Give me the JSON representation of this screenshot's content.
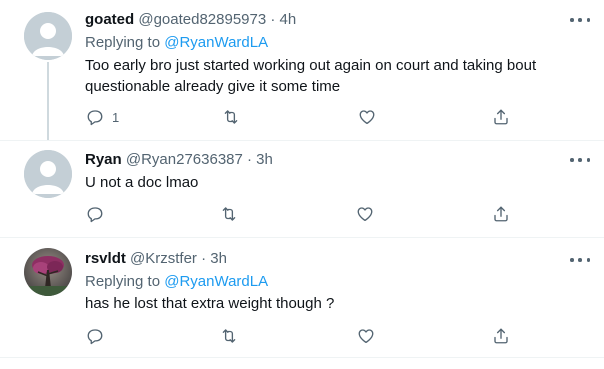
{
  "tweets": [
    {
      "name": "goated",
      "handle": "@goated82895973",
      "time": "· 4h",
      "replying_label": "Replying to",
      "replying_to": "@RyanWardLA",
      "text_line1": "Too early bro just started working out again on court and taking bout",
      "text_line2": "questionable already give it some time",
      "reply_count": "1",
      "avatar": "default-avatar-icon"
    },
    {
      "name": "Ryan",
      "handle": "@Ryan27636387",
      "time": "· 3h",
      "text_line1": "U not a doc lmao",
      "reply_count": "",
      "avatar": "default-avatar-icon"
    },
    {
      "name": "rsvldt",
      "handle": "@Krzstfer",
      "time": "· 3h",
      "replying_label": "Replying to",
      "replying_to": "@RyanWardLA",
      "text_line1": "has he lost that extra weight though ?",
      "reply_count": "",
      "avatar": "tree-avatar-photo"
    }
  ],
  "colors": {
    "accent": "#1d9bf0",
    "secondary_text": "#536471",
    "divider": "#eff3f4"
  }
}
